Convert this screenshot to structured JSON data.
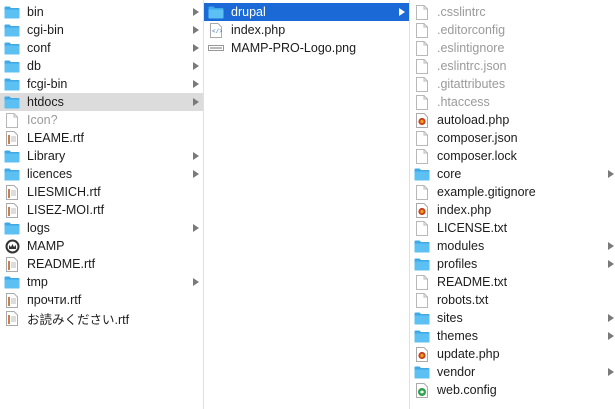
{
  "column1": {
    "items": [
      {
        "label": "bin",
        "icon": "folder-icon",
        "arrow": true
      },
      {
        "label": "cgi-bin",
        "icon": "folder-icon",
        "arrow": true
      },
      {
        "label": "conf",
        "icon": "folder-icon",
        "arrow": true
      },
      {
        "label": "db",
        "icon": "folder-icon",
        "arrow": true
      },
      {
        "label": "fcgi-bin",
        "icon": "folder-icon",
        "arrow": true
      },
      {
        "label": "htdocs",
        "icon": "folder-icon",
        "arrow": true,
        "selected": "gray"
      },
      {
        "label": "Icon?",
        "icon": "blank-file-icon",
        "dim": true
      },
      {
        "label": "LEAME.rtf",
        "icon": "rtf-file-icon"
      },
      {
        "label": "Library",
        "icon": "folder-icon",
        "arrow": true
      },
      {
        "label": "licences",
        "icon": "folder-icon",
        "arrow": true
      },
      {
        "label": "LIESMICH.rtf",
        "icon": "rtf-file-icon"
      },
      {
        "label": "LISEZ-MOI.rtf",
        "icon": "rtf-file-icon"
      },
      {
        "label": "logs",
        "icon": "folder-icon",
        "arrow": true
      },
      {
        "label": "MAMP",
        "icon": "mamp-app-icon"
      },
      {
        "label": "README.rtf",
        "icon": "rtf-file-icon"
      },
      {
        "label": "tmp",
        "icon": "folder-icon",
        "arrow": true
      },
      {
        "label": "прочти.rtf",
        "icon": "rtf-file-icon"
      },
      {
        "label": "お読みください.rtf",
        "icon": "rtf-file-icon"
      }
    ]
  },
  "column2": {
    "items": [
      {
        "label": "drupal",
        "icon": "folder-icon",
        "arrow": true,
        "selected": "blue"
      },
      {
        "label": "index.php",
        "icon": "php-file-icon"
      },
      {
        "label": "MAMP-PRO-Logo.png",
        "icon": "image-file-icon"
      }
    ]
  },
  "column3": {
    "items": [
      {
        "label": ".csslintrc",
        "icon": "blank-file-icon",
        "dim": true
      },
      {
        "label": ".editorconfig",
        "icon": "blank-file-icon",
        "dim": true
      },
      {
        "label": ".eslintignore",
        "icon": "blank-file-icon",
        "dim": true
      },
      {
        "label": ".eslintrc.json",
        "icon": "blank-file-icon",
        "dim": true
      },
      {
        "label": ".gitattributes",
        "icon": "blank-file-icon",
        "dim": true
      },
      {
        "label": ".htaccess",
        "icon": "blank-file-icon",
        "dim": true
      },
      {
        "label": "autoload.php",
        "icon": "php-badge-icon"
      },
      {
        "label": "composer.json",
        "icon": "blank-file-icon"
      },
      {
        "label": "composer.lock",
        "icon": "blank-file-icon"
      },
      {
        "label": "core",
        "icon": "folder-icon",
        "arrow": true
      },
      {
        "label": "example.gitignore",
        "icon": "blank-file-icon"
      },
      {
        "label": "index.php",
        "icon": "php-badge-icon"
      },
      {
        "label": "LICENSE.txt",
        "icon": "blank-file-icon"
      },
      {
        "label": "modules",
        "icon": "folder-icon",
        "arrow": true
      },
      {
        "label": "profiles",
        "icon": "folder-icon",
        "arrow": true
      },
      {
        "label": "README.txt",
        "icon": "blank-file-icon"
      },
      {
        "label": "robots.txt",
        "icon": "blank-file-icon"
      },
      {
        "label": "sites",
        "icon": "folder-icon",
        "arrow": true
      },
      {
        "label": "themes",
        "icon": "folder-icon",
        "arrow": true
      },
      {
        "label": "update.php",
        "icon": "php-badge-icon"
      },
      {
        "label": "vendor",
        "icon": "folder-icon",
        "arrow": true
      },
      {
        "label": "web.config",
        "icon": "config-file-icon"
      }
    ]
  },
  "colors": {
    "selection_blue": "#1b69d6",
    "selection_gray": "#dcdcdc",
    "folder_blue": "#4ab4ec",
    "dim_text": "#9a9a9a"
  }
}
